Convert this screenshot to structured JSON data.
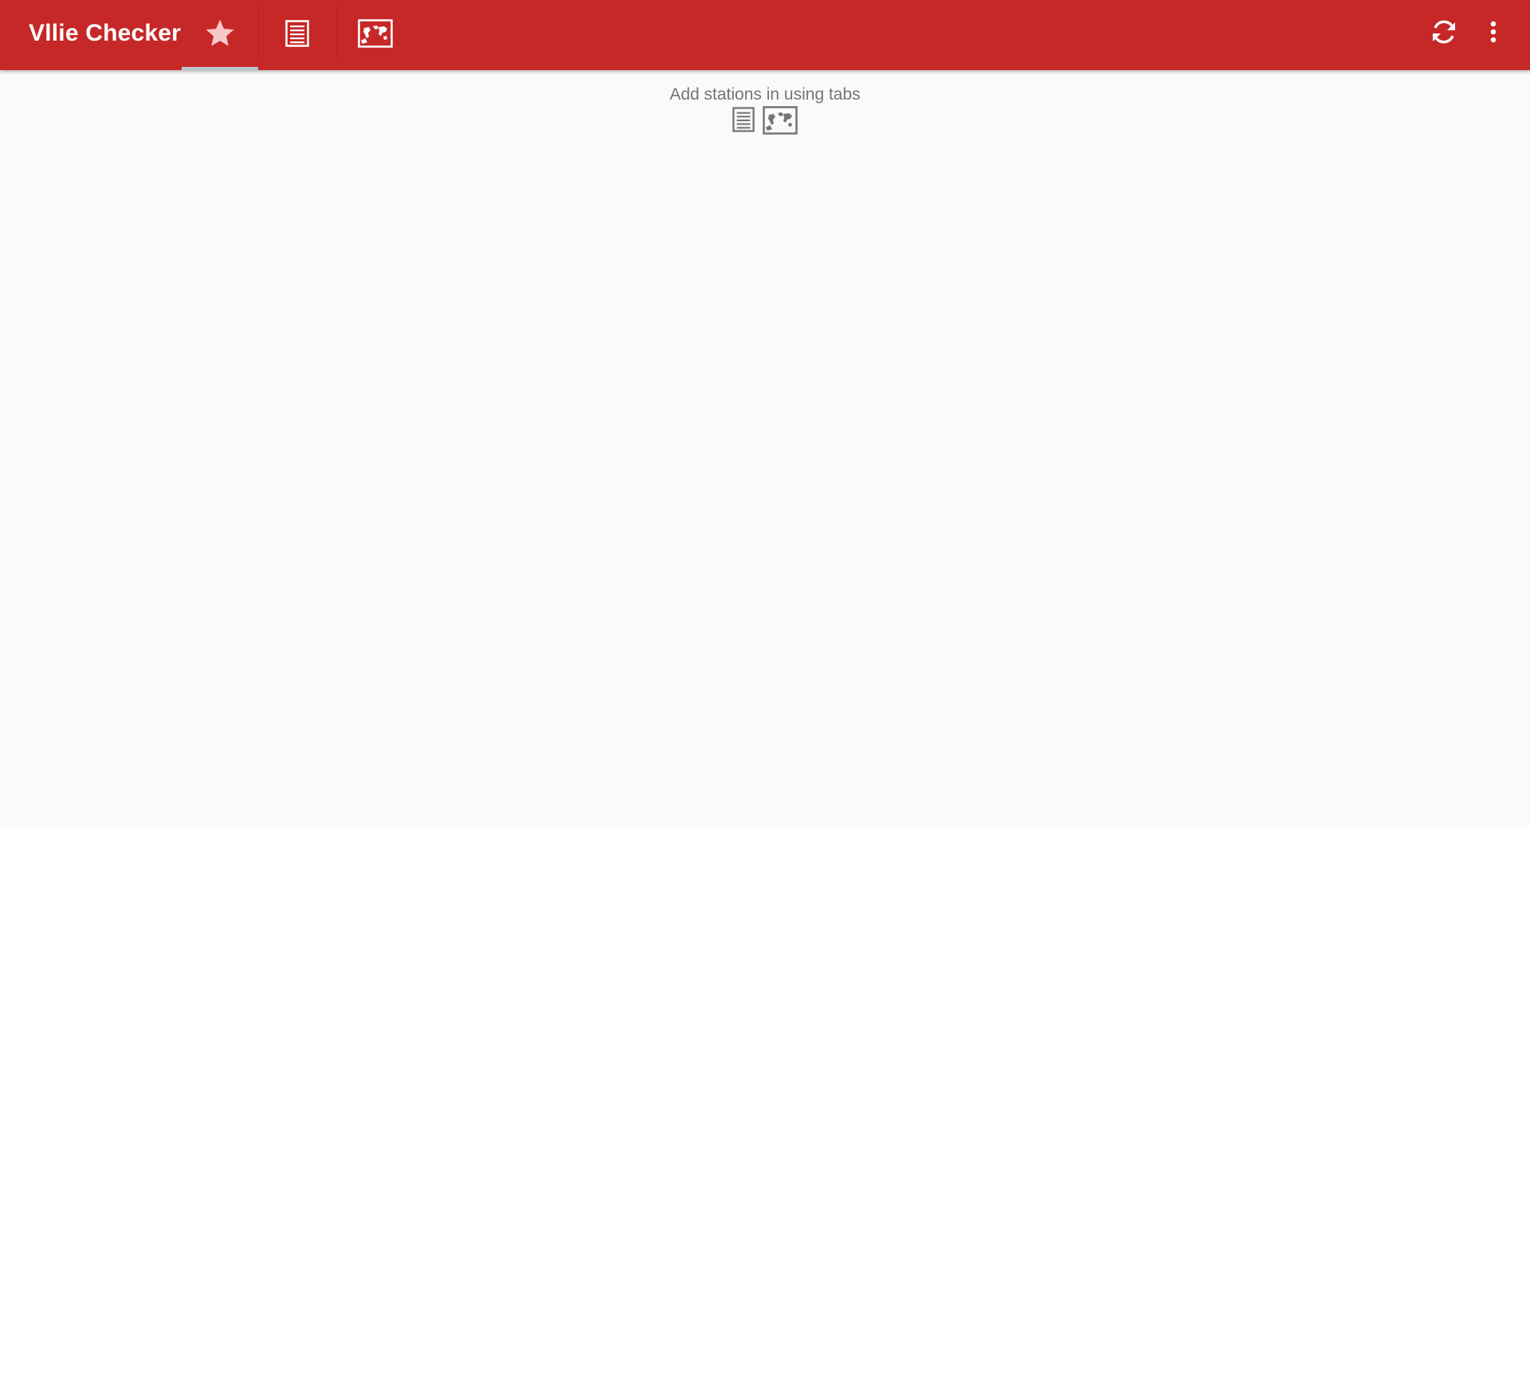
{
  "app": {
    "title": "Vllie Checker",
    "colors": {
      "primary": "#c62828",
      "background": "#fafafa",
      "tab_indicator": "#bcc6cc",
      "star_active": "#f8c8c8",
      "empty_text": "#757575"
    }
  },
  "toolbar": {
    "tabs": [
      {
        "id": "favorites",
        "icon": "star-icon",
        "selected": true
      },
      {
        "id": "list",
        "icon": "list-icon",
        "selected": false
      },
      {
        "id": "map",
        "icon": "map-icon",
        "selected": false
      }
    ],
    "actions": [
      {
        "id": "refresh",
        "icon": "refresh-icon"
      },
      {
        "id": "overflow",
        "icon": "more-vert-icon"
      }
    ]
  },
  "main": {
    "empty_message": "Add stations in using tabs",
    "hint_icons": [
      "list-icon",
      "map-icon"
    ]
  }
}
